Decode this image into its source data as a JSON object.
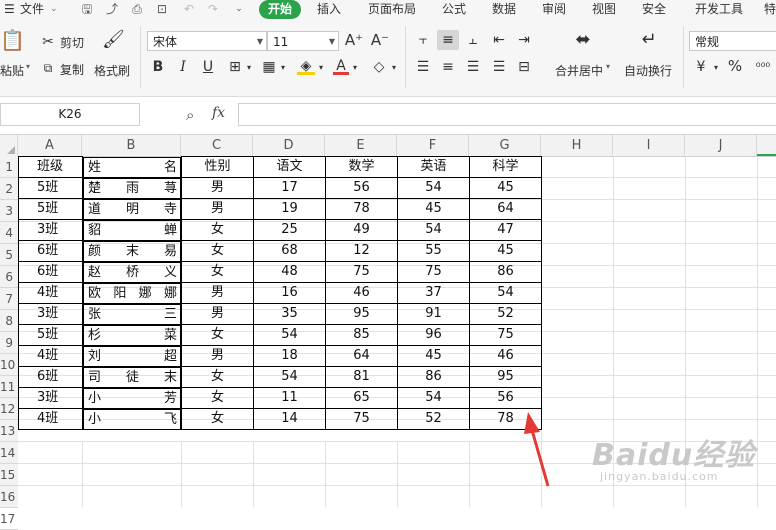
{
  "menu": {
    "file": "文件",
    "tabs": [
      "开始",
      "插入",
      "页面布局",
      "公式",
      "数据",
      "审阅",
      "视图",
      "安全",
      "开发工具",
      "特"
    ]
  },
  "ribbon": {
    "paste": "粘贴",
    "cut": "剪切",
    "copy": "复制",
    "format_painter": "格式刷",
    "font_name": "宋体",
    "font_size": "11",
    "merge_center": "合并居中",
    "wrap_text": "自动换行",
    "number_format": "常规",
    "percent_symbol": "%"
  },
  "formula_bar": {
    "cell_ref": "K26",
    "fx": "fx",
    "value": ""
  },
  "columns": [
    "A",
    "B",
    "C",
    "D",
    "E",
    "F",
    "G",
    "H",
    "I",
    "J"
  ],
  "row_numbers": [
    "1",
    "2",
    "3",
    "4",
    "5",
    "6",
    "7",
    "8",
    "9",
    "10",
    "11",
    "12",
    "13",
    "14",
    "15",
    "16",
    "17"
  ],
  "sheet": {
    "header": [
      "班级",
      [
        "姓",
        "名"
      ],
      "性别",
      "语文",
      "数学",
      "英语",
      "科学"
    ],
    "rows": [
      [
        "5班",
        [
          "楚",
          "雨",
          "荨"
        ],
        "男",
        "17",
        "56",
        "54",
        "45"
      ],
      [
        "5班",
        [
          "道",
          "明",
          "寺"
        ],
        "男",
        "19",
        "78",
        "45",
        "64"
      ],
      [
        "3班",
        [
          "貂",
          "蝉"
        ],
        "女",
        "25",
        "49",
        "54",
        "47"
      ],
      [
        "6班",
        [
          "颜",
          "末",
          "易"
        ],
        "女",
        "68",
        "12",
        "55",
        "45"
      ],
      [
        "6班",
        [
          "赵",
          "桥",
          "义"
        ],
        "女",
        "48",
        "75",
        "75",
        "86"
      ],
      [
        "4班",
        [
          "欧",
          "阳",
          "娜",
          "娜"
        ],
        "男",
        "16",
        "46",
        "37",
        "54"
      ],
      [
        "3班",
        [
          "张",
          "三"
        ],
        "男",
        "35",
        "95",
        "91",
        "52"
      ],
      [
        "5班",
        [
          "杉",
          "菜"
        ],
        "女",
        "54",
        "85",
        "96",
        "75"
      ],
      [
        "4班",
        [
          "刘",
          "超"
        ],
        "男",
        "18",
        "64",
        "45",
        "46"
      ],
      [
        "6班",
        [
          "司",
          "徒",
          "末"
        ],
        "女",
        "54",
        "81",
        "86",
        "95"
      ],
      [
        "3班",
        [
          "小",
          "芳"
        ],
        "女",
        "11",
        "65",
        "54",
        "56"
      ],
      [
        "4班",
        [
          "小",
          "飞"
        ],
        "女",
        "14",
        "75",
        "52",
        "78"
      ]
    ]
  },
  "watermark": {
    "brand": "Baidu经验",
    "url": "jingyan.baidu.com"
  },
  "colors": {
    "accent": "#2aa34a",
    "arrow": "#e53935"
  }
}
